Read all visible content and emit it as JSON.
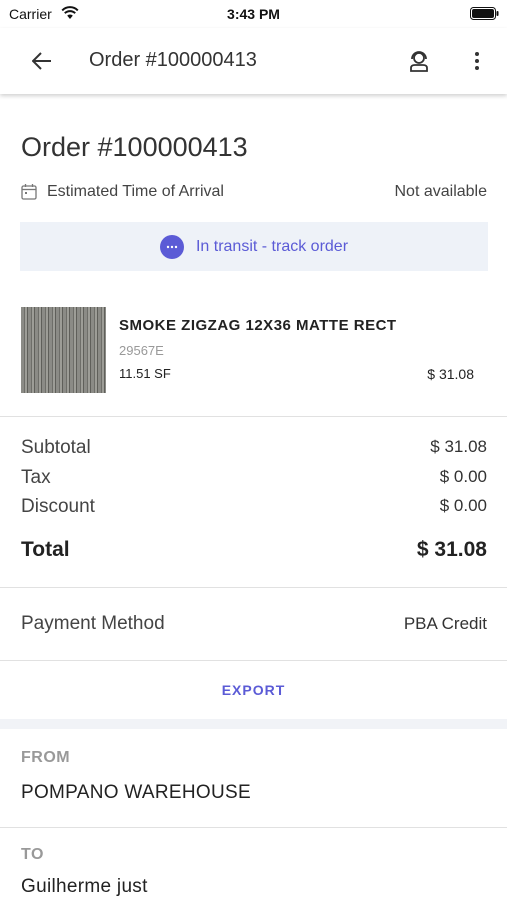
{
  "status_bar": {
    "carrier": "Carrier",
    "time": "3:43 PM"
  },
  "app_bar": {
    "title": "Order #100000413",
    "icons": [
      "back-arrow-icon",
      "support-agent-icon",
      "more-vert-icon"
    ]
  },
  "order": {
    "title": "Order #100000413",
    "eta_label": "Estimated Time of Arrival",
    "eta_value": "Not available",
    "transit_label": "In transit - track order"
  },
  "product": {
    "name": "SMOKE ZIGZAG 12X36 MATTE RECT",
    "sku": "29567E",
    "quantity": "11.51 SF",
    "price": "$ 31.08"
  },
  "totals": {
    "subtotal_label": "Subtotal",
    "subtotal_value": "$ 31.08",
    "tax_label": "Tax",
    "tax_value": "$ 0.00",
    "discount_label": "Discount",
    "discount_value": "$ 0.00",
    "total_label": "Total",
    "total_value": "$ 31.08"
  },
  "payment": {
    "label": "Payment Method",
    "value": "PBA Credit"
  },
  "export_label": "EXPORT",
  "from": {
    "label": "FROM",
    "value": "POMPANO WAREHOUSE"
  },
  "to": {
    "label": "TO",
    "value": "Guilherme just"
  },
  "colors": {
    "accent": "#5b5bd6",
    "banner_bg": "#eef2f8",
    "divider": "#e1e1e1"
  }
}
